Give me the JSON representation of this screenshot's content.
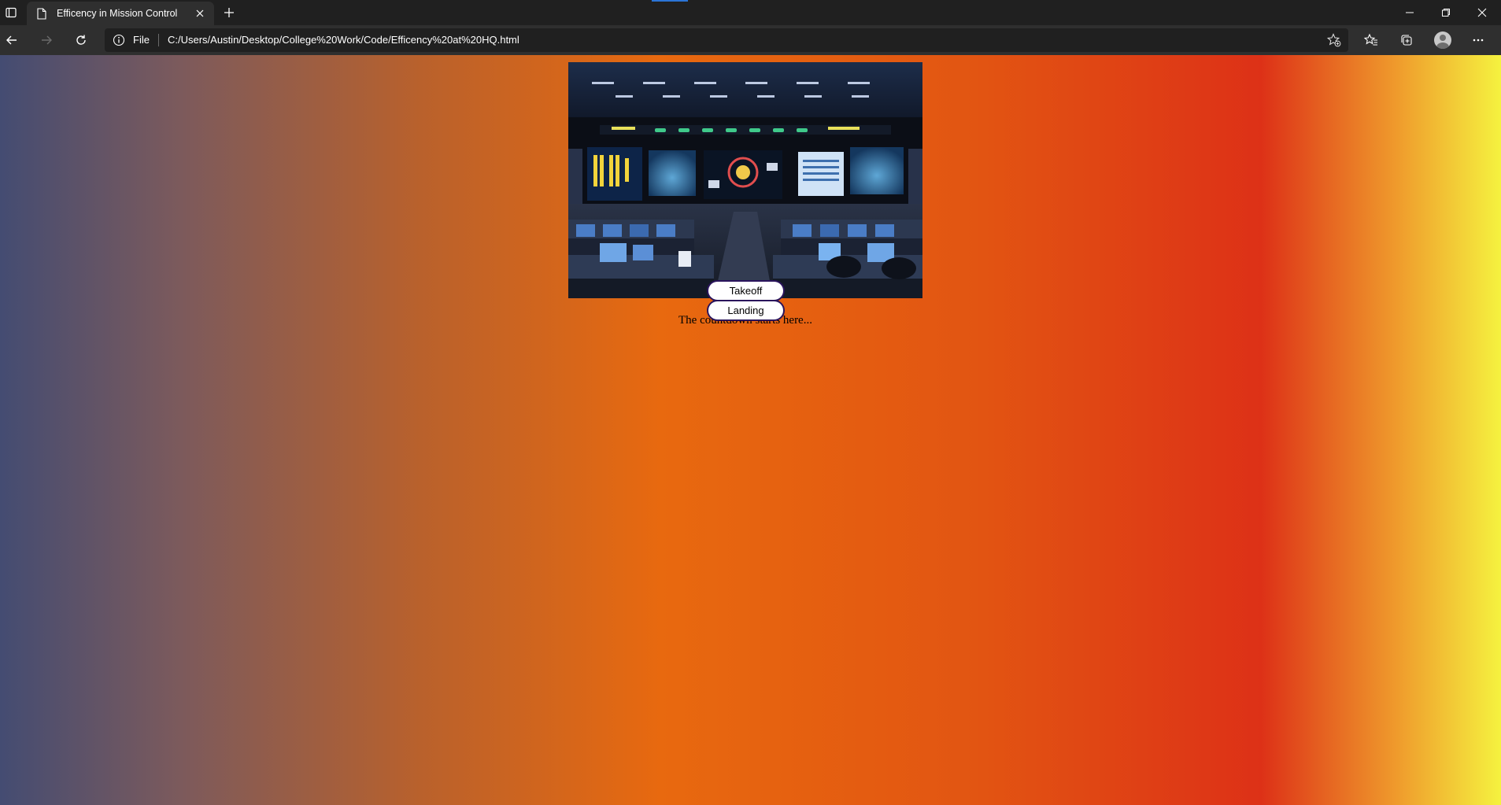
{
  "browser": {
    "tab": {
      "title": "Efficency in Mission Control"
    },
    "address": {
      "scheme": "File",
      "url": "C:/Users/Austin/Desktop/College%20Work/Code/Efficency%20at%20HQ.html"
    }
  },
  "page": {
    "tagline": "The countdown starts here...",
    "buttons": {
      "takeoff": "Takeoff",
      "landing": "Landing"
    },
    "background_colors": [
      "#444c72",
      "#b9612c",
      "#e8690f",
      "#dd3117",
      "#f5f23f"
    ]
  },
  "icons": [
    "tab-actions-icon",
    "page-icon",
    "close-icon",
    "plus-icon",
    "back-icon",
    "forward-icon",
    "refresh-icon",
    "info-icon",
    "add-favorite-icon",
    "favorites-icon",
    "collections-icon",
    "profile-icon",
    "more-icon",
    "minimize-icon",
    "restore-icon"
  ]
}
